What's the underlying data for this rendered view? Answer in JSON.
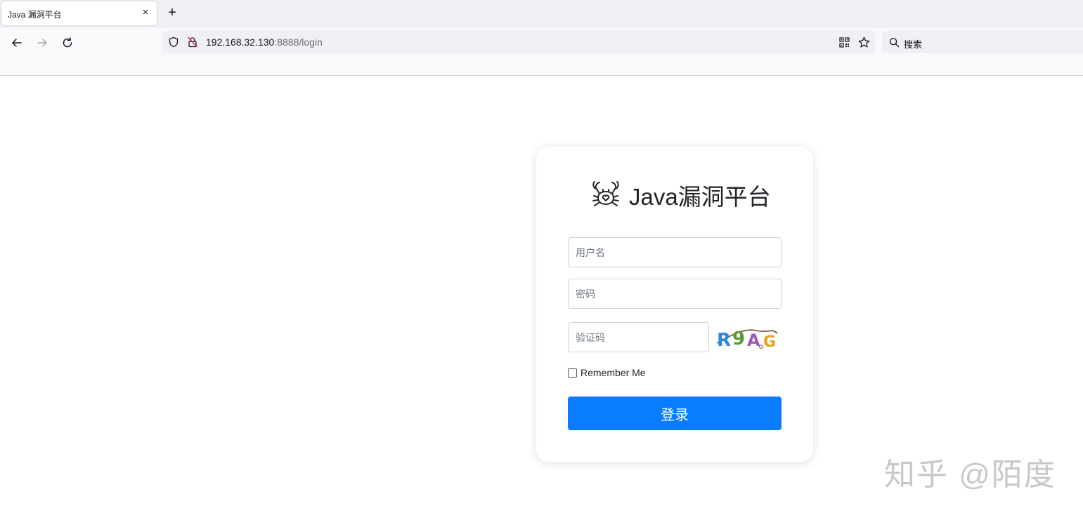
{
  "browser": {
    "tab_title": "Java 漏洞平台",
    "tab_close": "×",
    "new_tab": "+",
    "url_host": "192.168.32.130",
    "url_rest": ":8888/login",
    "search_placeholder": "搜索"
  },
  "login": {
    "title": "Java漏洞平台",
    "username_placeholder": "用户名",
    "password_placeholder": "密码",
    "captcha_placeholder": "验证码",
    "captcha_text": "R9AG",
    "remember_label": "Remember Me",
    "submit_label": "登录"
  },
  "watermark": "知乎 @陌度",
  "colors": {
    "primary": "#0a7cff",
    "background": "#ffffff"
  }
}
